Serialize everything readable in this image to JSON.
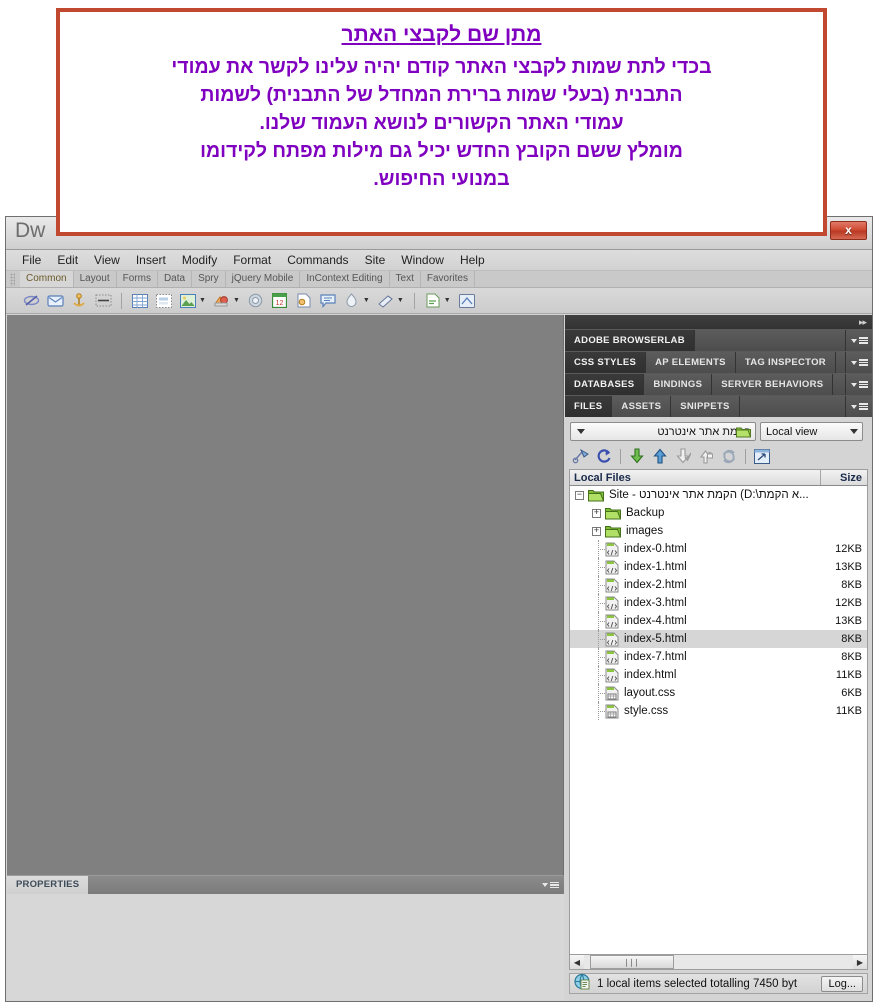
{
  "callout": {
    "title": "מתן שם לקבצי האתר",
    "lines": [
      "בכדי לתת שמות לקבצי האתר קודם יהיה עלינו לקשר את עמודי",
      "התבנית (בעלי שמות ברירת המחדל של התבנית) לשמות",
      "עמודי האתר הקשורים לנושא העמוד שלנו.",
      "מומלץ ששם הקובץ החדש יכיל גם מילות מפתח לקידומו",
      "במנועי החיפוש."
    ],
    "text_color": "#8000c0",
    "border_color": "#c0492f"
  },
  "window": {
    "app_logo": "Dw",
    "close_label": "x"
  },
  "menubar": {
    "items": [
      "File",
      "Edit",
      "View",
      "Insert",
      "Modify",
      "Format",
      "Commands",
      "Site",
      "Window",
      "Help"
    ]
  },
  "insert_tabs": {
    "items": [
      {
        "label": "Common",
        "active": true
      },
      {
        "label": "Layout",
        "active": false
      },
      {
        "label": "Forms",
        "active": false
      },
      {
        "label": "Data",
        "active": false
      },
      {
        "label": "Spry",
        "active": false
      },
      {
        "label": "jQuery Mobile",
        "active": false
      },
      {
        "label": "InContext Editing",
        "active": false
      },
      {
        "label": "Text",
        "active": false
      },
      {
        "label": "Favorites",
        "active": false
      }
    ]
  },
  "insert_toolbar": {
    "icons": [
      "hyperlink-icon",
      "email-link-icon",
      "named-anchor-icon",
      "horizontal-rule-icon",
      "table-icon",
      "insert-div-tag-icon",
      "image-icon",
      "media-icon",
      "widget-icon",
      "date-icon",
      "server-side-include-icon",
      "comment-icon",
      "head-icon",
      "script-icon",
      "template-icon",
      "tag-chooser-icon"
    ]
  },
  "panels": {
    "groups": [
      {
        "name": "browserlab-group",
        "tabs": [
          {
            "label": "ADOBE BROWSERLAB",
            "active": true
          }
        ]
      },
      {
        "name": "css-group",
        "tabs": [
          {
            "label": "CSS STYLES",
            "active": true
          },
          {
            "label": "AP ELEMENTS",
            "active": false
          },
          {
            "label": "TAG INSPECTOR",
            "active": false
          }
        ]
      },
      {
        "name": "databases-group",
        "tabs": [
          {
            "label": "DATABASES",
            "active": true
          },
          {
            "label": "BINDINGS",
            "active": false
          },
          {
            "label": "SERVER BEHAVIORS",
            "active": false
          }
        ]
      },
      {
        "name": "files-group",
        "tabs": [
          {
            "label": "FILES",
            "active": true
          },
          {
            "label": "ASSETS",
            "active": false
          },
          {
            "label": "SNIPPETS",
            "active": false
          }
        ]
      }
    ]
  },
  "files_panel": {
    "site_combo": {
      "value": "הקמת אתר אינטרנט",
      "icon": "folder-icon"
    },
    "view_combo": {
      "value": "Local view"
    },
    "toolbar_icons": [
      "connect-to-remote-host-icon",
      "refresh-icon",
      "get-files-icon",
      "put-files-icon",
      "check-out-icon",
      "check-in-icon",
      "synchronize-icon",
      "expand-panes-icon"
    ],
    "columns": {
      "name": "Local Files",
      "size": "Size"
    },
    "rows": [
      {
        "label": "Site - הקמת אתר אינטרנט (D:\\א הקמת...",
        "size": "",
        "type": "folder",
        "depth": 0,
        "expander": "minus",
        "selected": false
      },
      {
        "label": "Backup",
        "size": "",
        "type": "folder",
        "depth": 1,
        "expander": "plus",
        "selected": false
      },
      {
        "label": "images",
        "size": "",
        "type": "folder",
        "depth": 1,
        "expander": "plus",
        "selected": false
      },
      {
        "label": "index-0.html",
        "size": "12KB",
        "type": "html",
        "depth": 1,
        "expander": "none",
        "selected": false
      },
      {
        "label": "index-1.html",
        "size": "13KB",
        "type": "html",
        "depth": 1,
        "expander": "none",
        "selected": false
      },
      {
        "label": "index-2.html",
        "size": "8KB",
        "type": "html",
        "depth": 1,
        "expander": "none",
        "selected": false
      },
      {
        "label": "index-3.html",
        "size": "12KB",
        "type": "html",
        "depth": 1,
        "expander": "none",
        "selected": false
      },
      {
        "label": "index-4.html",
        "size": "13KB",
        "type": "html",
        "depth": 1,
        "expander": "none",
        "selected": false
      },
      {
        "label": "index-5.html",
        "size": "8KB",
        "type": "html",
        "depth": 1,
        "expander": "none",
        "selected": true
      },
      {
        "label": "index-7.html",
        "size": "8KB",
        "type": "html",
        "depth": 1,
        "expander": "none",
        "selected": false
      },
      {
        "label": "index.html",
        "size": "11KB",
        "type": "html",
        "depth": 1,
        "expander": "none",
        "selected": false
      },
      {
        "label": "layout.css",
        "size": "6KB",
        "type": "css",
        "depth": 1,
        "expander": "none",
        "selected": false
      },
      {
        "label": "style.css",
        "size": "11KB",
        "type": "css",
        "depth": 1,
        "expander": "none",
        "selected": false
      }
    ],
    "scrollbar": {
      "left_arrow": "◀",
      "right_arrow": "▶",
      "thumb_grip": "∣∣∣"
    },
    "status": {
      "icon": "globe-icon",
      "text": "1 local items selected totalling 7450 byt",
      "log_button": "Log..."
    }
  },
  "properties_panel": {
    "title": "PROPERTIES"
  }
}
